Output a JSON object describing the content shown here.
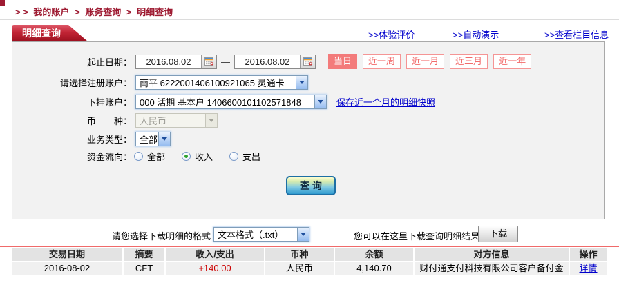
{
  "breadcrumb": {
    "prefix": "> >",
    "separator": ">",
    "items": [
      "我的账户",
      "账务查询",
      "明细查询"
    ]
  },
  "tab": {
    "label": "明细查询"
  },
  "header_links": [
    {
      "arrows": ">>",
      "label": "体验评价"
    },
    {
      "arrows": ">>",
      "label": "自动演示"
    },
    {
      "arrows": ">>",
      "label": "查看栏目信息"
    }
  ],
  "form": {
    "date_range": {
      "label": "起止日期：",
      "start_value": "2016.08.02",
      "end_value": "2016.08.02",
      "separator": "—"
    },
    "quick_ranges": [
      {
        "label": "当日",
        "active": true
      },
      {
        "label": "近一周",
        "active": false
      },
      {
        "label": "近一月",
        "active": false
      },
      {
        "label": "近三月",
        "active": false
      },
      {
        "label": "近一年",
        "active": false
      }
    ],
    "register_account": {
      "label": "请选择注册账户：",
      "value": "南平 6222001406100921065 灵通卡"
    },
    "sub_account": {
      "label": "下挂账户：",
      "value": "000 活期 基本户 1406600101102571848",
      "snapshot_link": "保存近一个月的明细快照"
    },
    "currency": {
      "label": "币　　种：",
      "value": "人民币",
      "disabled": true
    },
    "business_type": {
      "label": "业务类型：",
      "value": "全部"
    },
    "fund_flow": {
      "label": "资金流向：",
      "options": [
        {
          "label": "全部",
          "checked": false
        },
        {
          "label": "收入",
          "checked": true
        },
        {
          "label": "支出",
          "checked": false
        }
      ]
    },
    "query_button": "查 询"
  },
  "download": {
    "format_label": "请您选择下载明细的格式",
    "format_value": "文本格式（.txt）",
    "hint": "您可以在这里下载查询明细结果",
    "button_label": "下载"
  },
  "table": {
    "headers": [
      "交易日期",
      "摘要",
      "收入/支出",
      "币种",
      "余额",
      "对方信息",
      "操作"
    ],
    "rows": [
      {
        "date": "2016-08-02",
        "summary": "CFT",
        "amount": "+140.00",
        "currency": "人民币",
        "balance": "4,140.70",
        "counterparty": "财付通支付科技有限公司客户备付金",
        "action": "详情"
      }
    ]
  },
  "colors": {
    "brand_red": "#9e1b32",
    "tab_gradient_top": "#dd5868",
    "tab_gradient_bottom": "#9c101f",
    "link_blue": "#0000cc",
    "salmon_accent": "#f37b7b",
    "amount_red": "#cc0000",
    "table_line_red": "#f06a6a"
  }
}
